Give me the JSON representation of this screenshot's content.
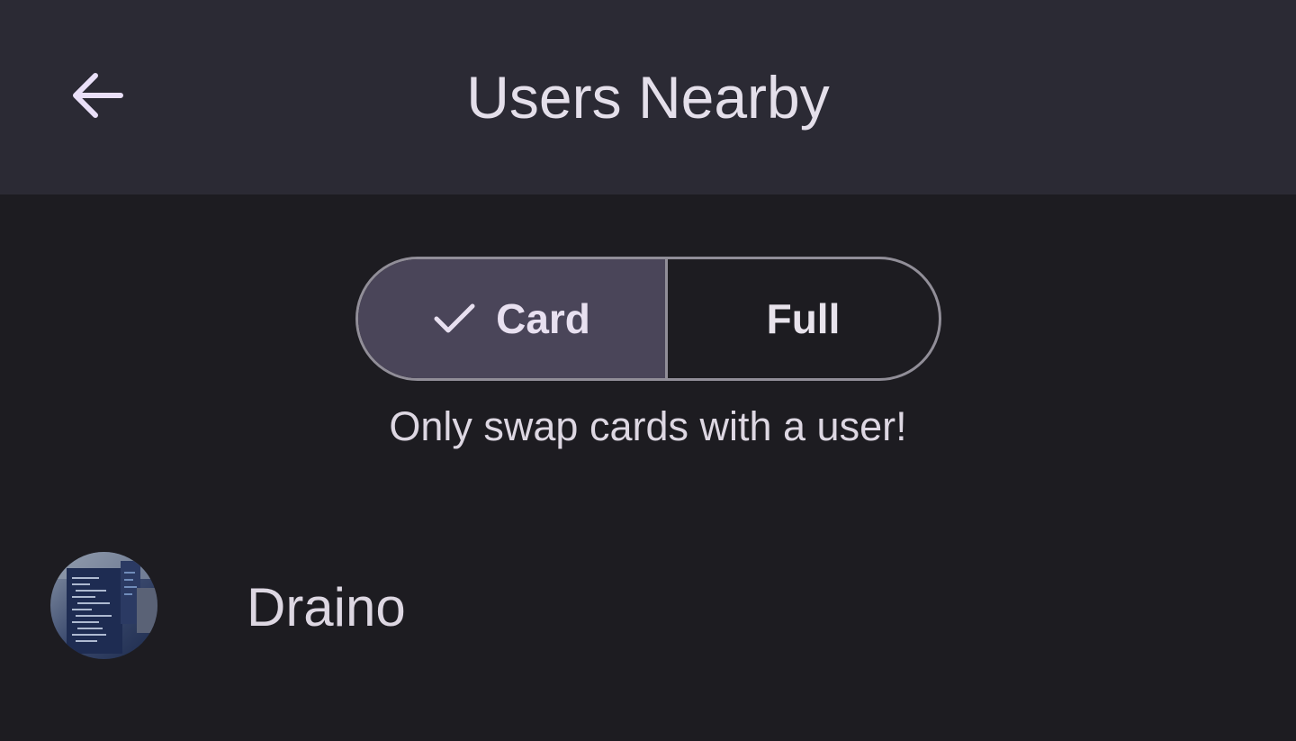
{
  "header": {
    "title": "Users Nearby",
    "back_icon": "arrow-left-icon"
  },
  "mode_toggle": {
    "options": [
      {
        "label": "Card",
        "selected": true,
        "icon": "check-icon"
      },
      {
        "label": "Full",
        "selected": false
      }
    ]
  },
  "hint_text": "Only swap cards with a user!",
  "users": [
    {
      "name": "Draino",
      "avatar": "avatar-image"
    }
  ],
  "colors": {
    "background": "#1d1c21",
    "topbar": "#2b2a34",
    "selected_segment": "#4a4559",
    "outline": "#918e98",
    "text": "#e4dfea"
  }
}
